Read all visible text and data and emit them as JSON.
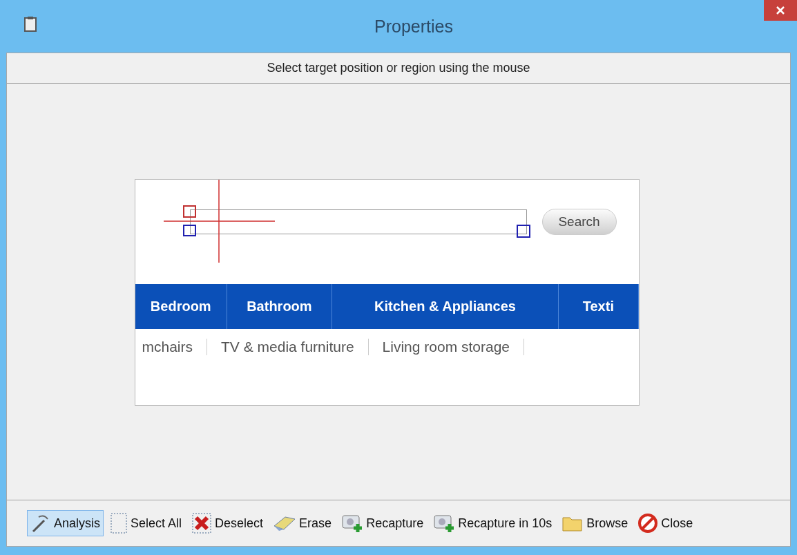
{
  "window": {
    "title": "Properties"
  },
  "instruction": "Select target position or region using the mouse",
  "capture": {
    "search_button": "Search",
    "nav": [
      {
        "label": "Bedroom"
      },
      {
        "label": "Bathroom"
      },
      {
        "label": "Kitchen & Appliances"
      },
      {
        "label": "Texti"
      }
    ],
    "links": [
      "mchairs",
      "TV & media furniture",
      "Living room storage"
    ]
  },
  "toolbar": [
    {
      "kind": "analysis",
      "label": "Analysis",
      "selected": true
    },
    {
      "kind": "select-all",
      "label": "Select All",
      "selected": false
    },
    {
      "kind": "deselect",
      "label": "Deselect",
      "selected": false
    },
    {
      "kind": "erase",
      "label": "Erase",
      "selected": false
    },
    {
      "kind": "recapture",
      "label": "Recapture",
      "selected": false
    },
    {
      "kind": "recapture",
      "label": "Recapture in 10s",
      "selected": false
    },
    {
      "kind": "browse",
      "label": "Browse",
      "selected": false
    },
    {
      "kind": "close",
      "label": "Close",
      "selected": false
    }
  ]
}
